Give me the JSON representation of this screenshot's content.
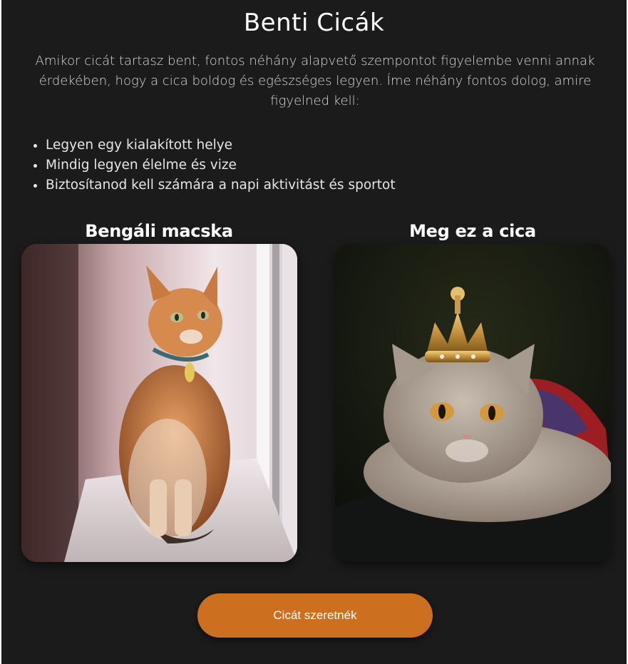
{
  "page": {
    "title": "Benti Cicák",
    "intro": "Amikor cicát tartasz bent, fontos néhány alapvető szempontot figyelembe venni annak érdekében, hogy a cica boldog és egészséges legyen. Íme néhány fontos dolog, amire figyelned kell:",
    "tips": [
      "Legyen egy kialakított helye",
      "Mindig legyen élelme és vize",
      "Biztosítanod kell számára a napi aktivitást és sportot"
    ]
  },
  "cards": [
    {
      "title": "Bengáli macska"
    },
    {
      "title": "Meg ez a cica"
    }
  ],
  "cta": {
    "label": "Cicát szeretnék"
  },
  "colors": {
    "background": "#1c1b1b",
    "accent": "#cc6f1f",
    "text": "#ffffff"
  }
}
